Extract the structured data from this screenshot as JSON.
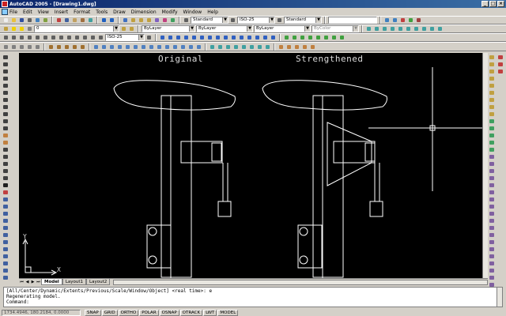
{
  "titlebar": {
    "title": "AutoCAD 2005 - [Drawing1.dwg]",
    "controls": [
      "_",
      "□",
      "×"
    ]
  },
  "menubar": {
    "items": [
      "File",
      "Edit",
      "View",
      "Insert",
      "Format",
      "Tools",
      "Draw",
      "Dimension",
      "Modify",
      "Window",
      "Help"
    ]
  },
  "toolbar1": {
    "text_style": "Standard",
    "dim_style": "ISO-25",
    "table_style": "Standard"
  },
  "toolbar2": {
    "layer": "0",
    "color": "ByLayer",
    "linetype": "ByLayer",
    "lineweight": "ByLayer",
    "plotstyle": "ByColor"
  },
  "toolbar3": {
    "dim_style2": "ISO-25"
  },
  "drawing": {
    "label_left": "Original",
    "label_right": "Strengthened",
    "ucs_x": "X",
    "ucs_y": "Y"
  },
  "tabs": {
    "items": [
      "Model",
      "Layout1",
      "Layout2"
    ],
    "active": 0
  },
  "command": {
    "history1": "[All/Center/Dynamic/Extents/Previous/Scale/Window/Object] <real time>: e",
    "history2": "Regenerating model.",
    "prompt": "Command:"
  },
  "status": {
    "coords": "1734.4946, 180.2184, 0.0000",
    "buttons": [
      "SNAP",
      "GRID",
      "ORTHO",
      "POLAR",
      "OSNAP",
      "OTRACK",
      "LWT",
      "MODEL"
    ]
  },
  "colors": {
    "canvas": "#000000",
    "geometry": "#ffffff",
    "chrome": "#d4d0c8",
    "titlebar": "#0a246a"
  }
}
